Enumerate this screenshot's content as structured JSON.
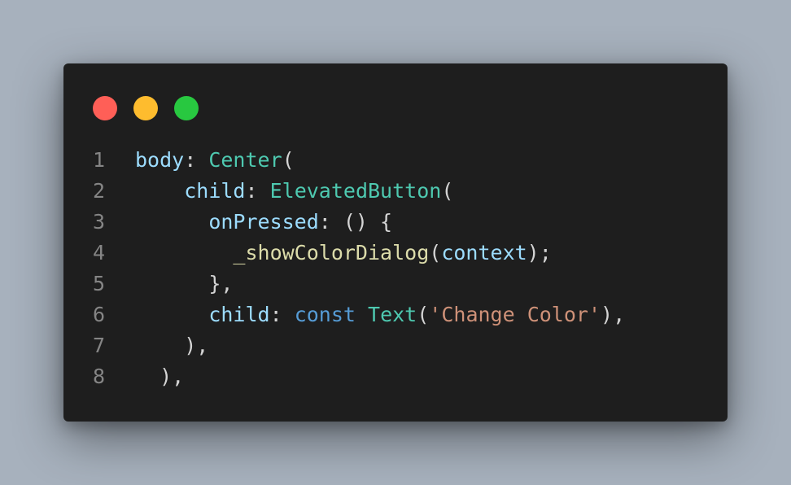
{
  "window": {
    "controls": [
      "close",
      "minimize",
      "maximize"
    ]
  },
  "colors": {
    "background": "#a7b1bd",
    "editor": "#1e1e1e",
    "close": "#ff5f57",
    "minimize": "#febc2e",
    "maximize": "#28c840",
    "property": "#9cdcfe",
    "class": "#4ec9b0",
    "keyword": "#569cd6",
    "function": "#dcdcaa",
    "string": "#ce9178",
    "punctuation": "#d4d4d4",
    "line_number": "#858585"
  },
  "code": {
    "lines": [
      {
        "number": "1",
        "indent": "",
        "tokens": [
          {
            "t": "prop",
            "v": "body"
          },
          {
            "t": "pun",
            "v": ": "
          },
          {
            "t": "cls",
            "v": "Center"
          },
          {
            "t": "pun",
            "v": "("
          }
        ]
      },
      {
        "number": "2",
        "indent": "    ",
        "tokens": [
          {
            "t": "prop",
            "v": "child"
          },
          {
            "t": "pun",
            "v": ": "
          },
          {
            "t": "cls",
            "v": "ElevatedButton"
          },
          {
            "t": "pun",
            "v": "("
          }
        ]
      },
      {
        "number": "3",
        "indent": "      ",
        "tokens": [
          {
            "t": "prop",
            "v": "onPressed"
          },
          {
            "t": "pun",
            "v": ": () {"
          }
        ]
      },
      {
        "number": "4",
        "indent": "        ",
        "tokens": [
          {
            "t": "fn",
            "v": "_showColorDialog"
          },
          {
            "t": "pun",
            "v": "("
          },
          {
            "t": "prop",
            "v": "context"
          },
          {
            "t": "pun",
            "v": ");"
          }
        ]
      },
      {
        "number": "5",
        "indent": "      ",
        "tokens": [
          {
            "t": "pun",
            "v": "},"
          }
        ]
      },
      {
        "number": "6",
        "indent": "      ",
        "tokens": [
          {
            "t": "prop",
            "v": "child"
          },
          {
            "t": "pun",
            "v": ": "
          },
          {
            "t": "kw",
            "v": "const"
          },
          {
            "t": "pun",
            "v": " "
          },
          {
            "t": "cls",
            "v": "Text"
          },
          {
            "t": "pun",
            "v": "("
          },
          {
            "t": "str",
            "v": "'Change Color'"
          },
          {
            "t": "pun",
            "v": "),"
          }
        ]
      },
      {
        "number": "7",
        "indent": "    ",
        "tokens": [
          {
            "t": "pun",
            "v": "),"
          }
        ]
      },
      {
        "number": "8",
        "indent": "  ",
        "tokens": [
          {
            "t": "pun",
            "v": "),"
          }
        ]
      }
    ]
  }
}
